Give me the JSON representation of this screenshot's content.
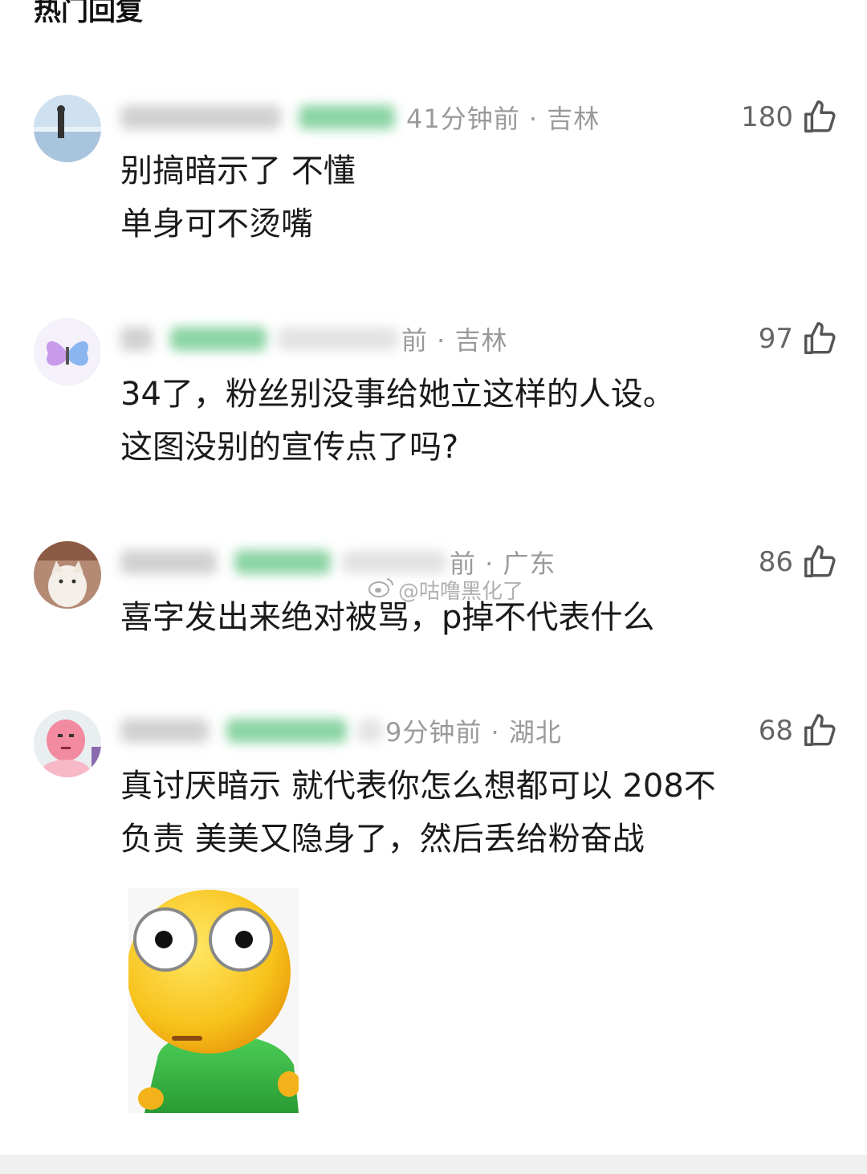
{
  "section_title": "热门回复",
  "watermark": "@咕噜黑化了",
  "comments": [
    {
      "meta_visible": "41分钟前 · 吉林",
      "likes": "180",
      "lines": [
        "别搞暗示了 不懂",
        "单身可不烫嘴"
      ]
    },
    {
      "meta_visible": "前 · 吉林",
      "likes": "97",
      "lines": [
        "34了，粉丝别没事给她立这样的人设。",
        "这图没别的宣传点了吗?"
      ]
    },
    {
      "meta_visible": "前 · 广东",
      "likes": "86",
      "lines": [
        "喜字发出来绝对被骂，p掉不代表什么"
      ]
    },
    {
      "meta_visible": "9分钟前 · 湖北",
      "likes": "68",
      "lines": [
        "真讨厌暗示  就代表你怎么想都可以  208不",
        "负责 美美又隐身了，然后丢给粉奋战"
      ]
    }
  ],
  "icons": {
    "like": "thumbs-up-icon",
    "watermark": "weibo-logo-icon"
  },
  "colors": {
    "meta_text": "#9a9a9a",
    "like_count": "#666666",
    "badge_green": "#7fcf9a"
  }
}
